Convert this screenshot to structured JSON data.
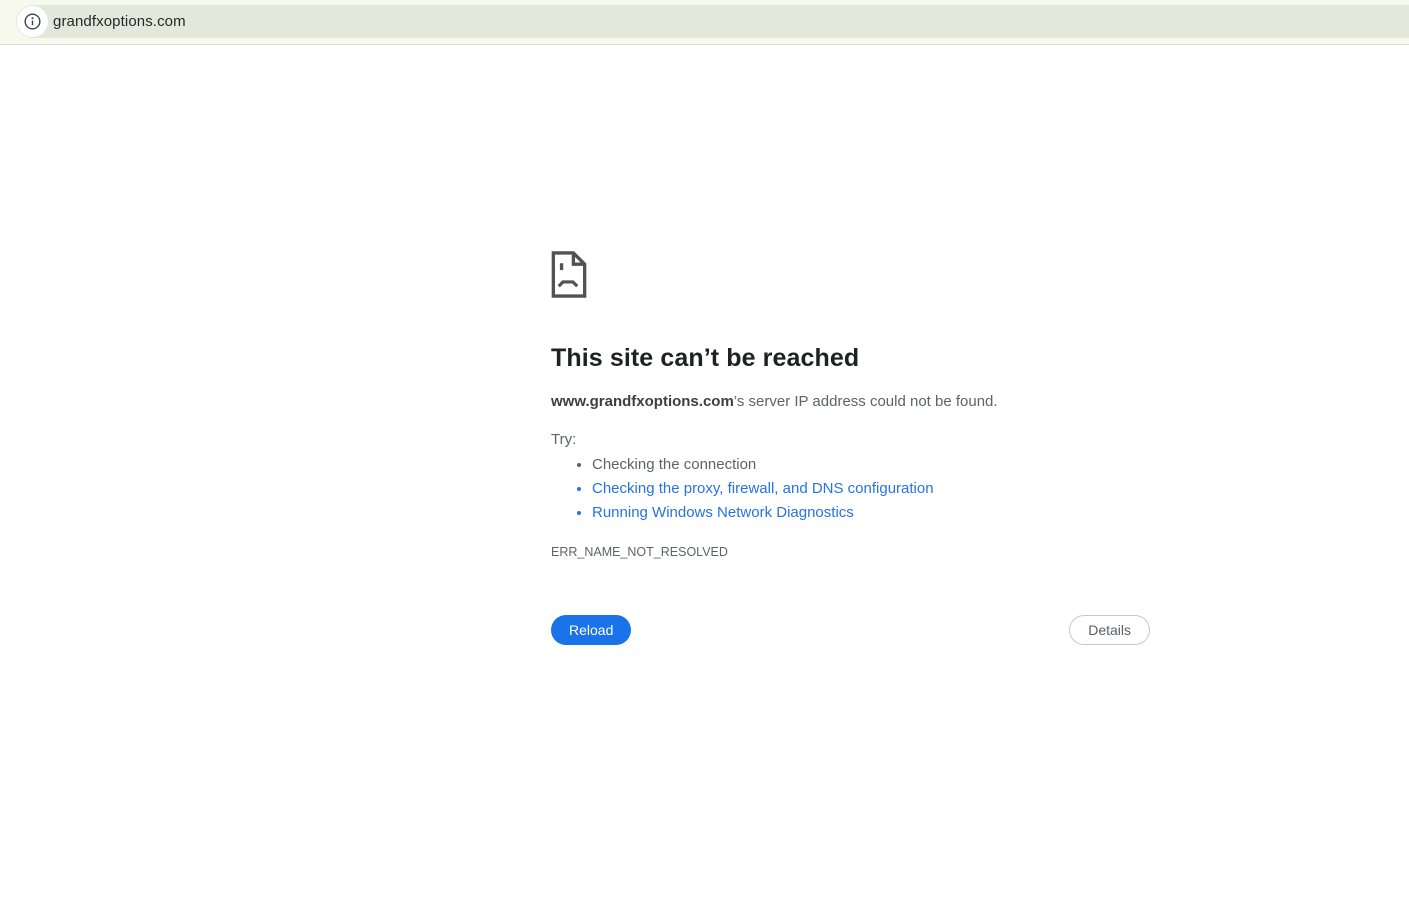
{
  "toolbar": {
    "url": "grandfxoptions.com",
    "info_icon": "info-icon"
  },
  "error_page": {
    "title": "This site can’t be reached",
    "domain": "www.grandfxoptions.com",
    "message_rest": "’s server IP address could not be found.",
    "try_label": "Try:",
    "suggestions": [
      {
        "label": "Checking the connection",
        "is_link": false
      },
      {
        "label": "Checking the proxy, firewall, and DNS configuration",
        "is_link": true
      },
      {
        "label": "Running Windows Network Diagnostics",
        "is_link": true
      }
    ],
    "error_code": "ERR_NAME_NOT_RESOLVED",
    "reload_label": "Reload",
    "details_label": "Details"
  },
  "colors": {
    "accent_blue": "#1a73e8",
    "link_blue": "#2673e2",
    "toolbar_background": "#f7f9ef",
    "omnibox_background": "#e3e9da",
    "text_gray": "#5f6368",
    "heading_dark": "#202124"
  }
}
